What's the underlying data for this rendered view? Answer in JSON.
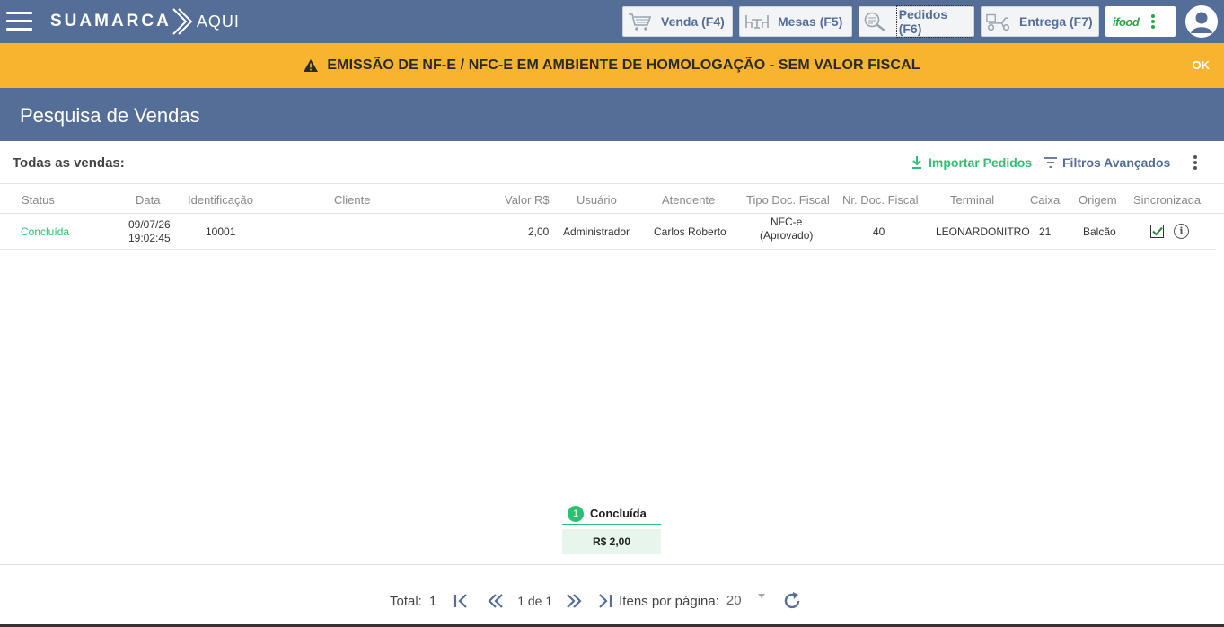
{
  "header": {
    "logo_brand": "SUAMARCA",
    "logo_suffix": "AQUI",
    "nav": [
      {
        "label": "Venda (F4)",
        "icon": "cart-icon"
      },
      {
        "label": "Mesas (F5)",
        "icon": "tables-icon"
      },
      {
        "label": "Pedidos (F6)",
        "icon": "orders-search-icon",
        "active": true
      },
      {
        "label": "Entrega (F7)",
        "icon": "delivery-scooter-icon"
      }
    ],
    "ifood_label": "ifood"
  },
  "banner": {
    "text": "EMISSÃO DE NF-E / NFC-E EM AMBIENTE DE HOMOLOGAÇÃO - SEM VALOR FISCAL",
    "ok_label": "OK",
    "color": "#f8b42e"
  },
  "page": {
    "title": "Pesquisa de Vendas"
  },
  "toolbar": {
    "label": "Todas as vendas:",
    "import_label": "Importar Pedidos",
    "filters_label": "Filtros Avançados"
  },
  "table": {
    "columns": [
      "Status",
      "Data",
      "Identificação",
      "Cliente",
      "Valor R$",
      "Usuário",
      "Atendente",
      "Tipo Doc. Fiscal",
      "Nr. Doc. Fiscal",
      "Terminal",
      "Caixa",
      "Origem",
      "Sincronizada"
    ],
    "rows": [
      {
        "status": "Concluída",
        "date": "09/07/26",
        "time": "19:02:45",
        "id": "10001",
        "client": "",
        "value": "2,00",
        "user": "Administrador",
        "attendant": "Carlos Roberto",
        "doc_type": "NFC-e",
        "doc_status": "(Aprovado)",
        "doc_number": "40",
        "terminal": "LEONARDONITRO",
        "cashier": "21",
        "origin": "Balcão",
        "synced": true
      }
    ]
  },
  "summary": {
    "count": "1",
    "label": "Concluída",
    "amount": "R$ 2,00"
  },
  "pagination": {
    "total_label": "Total:",
    "total": "1",
    "page_info": "1 de 1",
    "per_page_label": "Itens por página:",
    "per_page": "20"
  },
  "colors": {
    "primary": "#546e98",
    "success": "#2ebf72",
    "warning": "#f8b42e"
  }
}
